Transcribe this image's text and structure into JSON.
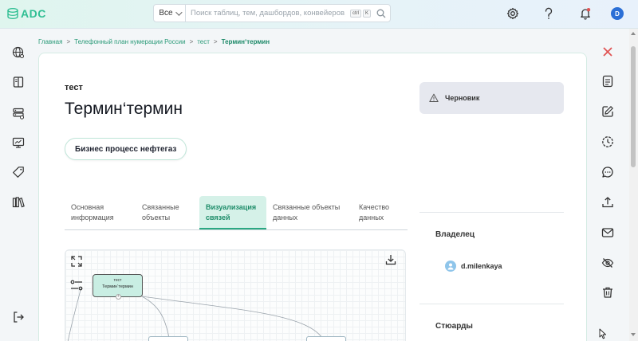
{
  "app": {
    "name": "ADC"
  },
  "search": {
    "scope": "Все",
    "placeholder": "Поиск таблиц, тем, дашбордов, конвейеров, м...",
    "shortcut_keys": [
      "ctrl",
      "K"
    ]
  },
  "header": {
    "icons": [
      "gear-icon",
      "help-icon",
      "bell-icon"
    ],
    "user_initial": "D"
  },
  "left_nav": [
    "globe-icon",
    "book-icon",
    "database-icon",
    "monitor-icon",
    "tag-icon",
    "library-icon",
    "logout-icon"
  ],
  "right_actions": [
    "close-icon",
    "document-icon",
    "edit-icon",
    "history-icon",
    "comment-icon",
    "upload-icon",
    "mail-icon",
    "hide-icon",
    "trash-icon"
  ],
  "breadcrumb": {
    "items": [
      "Главная",
      "Телефонный план нумерации России",
      "тест"
    ],
    "current": "Термин‘термин",
    "separator": ">"
  },
  "term": {
    "overline": "тест",
    "title": "Термин‘термин",
    "domain": "Бизнес процесс нефтегаз"
  },
  "status": {
    "label": "Черновик"
  },
  "tabs": [
    {
      "label": "Основная информация",
      "active": false
    },
    {
      "label": "Связанные объекты",
      "active": false
    },
    {
      "label": "Визуализация связей",
      "active": true
    },
    {
      "label": "Связанные объекты данных",
      "active": false
    },
    {
      "label": "Качество данных",
      "active": false
    }
  ],
  "graph": {
    "node": {
      "type": "тест",
      "label": "Термин‘термин"
    }
  },
  "side": {
    "owner_label": "Владелец",
    "owner_name": "d.milenkaya",
    "stewards_label": "Стюарды"
  },
  "colors": {
    "accent": "#2aa882",
    "accent_light": "#d5f1e8",
    "danger": "#e05353",
    "status_bg": "#e6e8ef"
  }
}
